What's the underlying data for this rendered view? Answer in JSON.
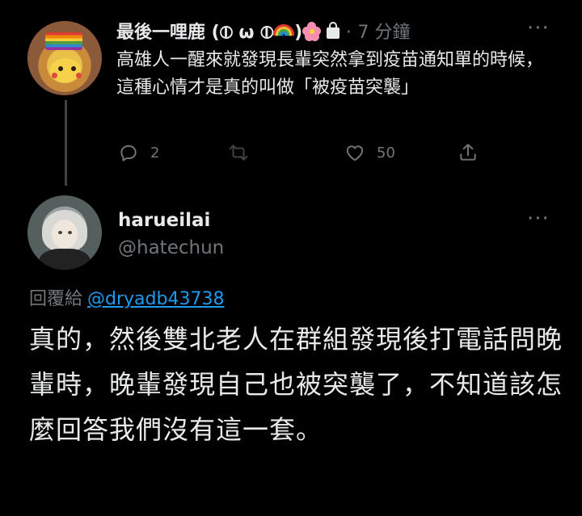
{
  "parent_tweet": {
    "author_name": "最後一哩鹿 (⦶ ω ⦶",
    "author_name_suffix": ")",
    "separator": "·",
    "time": "7 分鐘",
    "text": "高雄人一醒來就發現長輩突然拿到疫苗通知單的時候，這種心情才是真的叫做「被疫苗突襲」",
    "actions": {
      "reply_count": "2",
      "retweet_count": "",
      "like_count": "50"
    }
  },
  "reply_tweet": {
    "author_name": "harueilai",
    "handle": "@hatechun",
    "reply_prefix": "回覆給",
    "reply_to": "@dryadb43738",
    "text": "真的，然後雙北老人在群組發現後打電話問晚輩時，晚輩發現自己也被突襲了，不知道該怎麼回答我們沒有這一套。"
  },
  "more_label": "···",
  "colors": {
    "background": "#000000",
    "text": "#e7e9ea",
    "muted": "#71767b",
    "link": "#1d9bf0",
    "thread_line": "#3d4247"
  },
  "icons": [
    "avatar",
    "rainbow-emoji",
    "cherry-blossom-emoji",
    "lock-icon",
    "more-icon",
    "reply-icon",
    "retweet-icon",
    "like-icon",
    "share-icon"
  ]
}
